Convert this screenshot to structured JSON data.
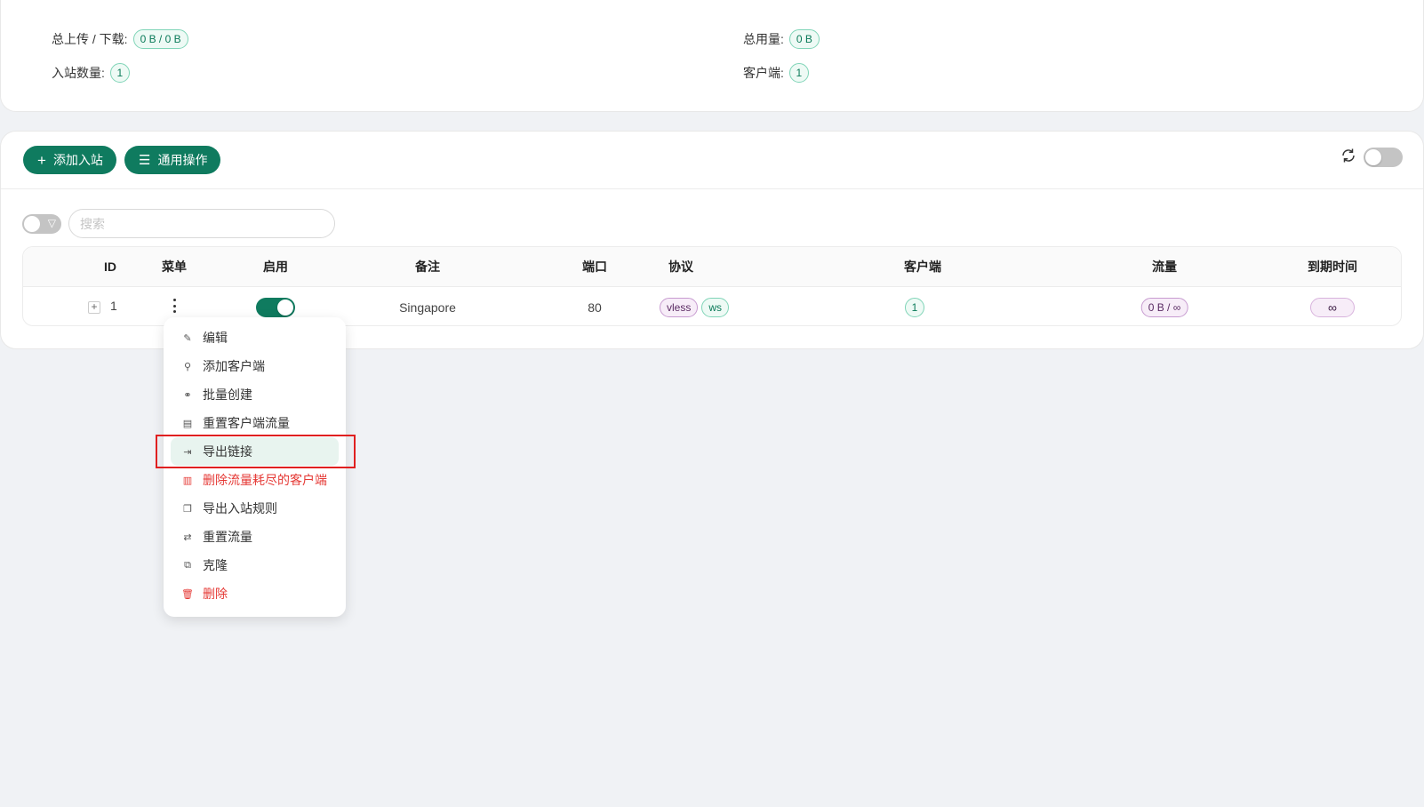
{
  "stats": {
    "total_updown_label": "总上传 / 下载:",
    "total_updown_value": "0 B / 0 B",
    "total_usage_label": "总用量:",
    "total_usage_value": "0 B",
    "inbound_count_label": "入站数量:",
    "inbound_count_value": "1",
    "clients_label": "客户端:",
    "clients_value": "1"
  },
  "toolbar": {
    "add_inbound_label": "添加入站",
    "general_actions_label": "通用操作"
  },
  "search": {
    "placeholder": "搜索"
  },
  "table": {
    "headers": {
      "id": "ID",
      "menu": "菜单",
      "enable": "启用",
      "remark": "备注",
      "port": "端口",
      "protocol": "协议",
      "clients": "客户端",
      "traffic": "流量",
      "expiry": "到期时间"
    },
    "rows": [
      {
        "id": "1",
        "remark": "Singapore",
        "port": "80",
        "protocol": "vless",
        "transport": "ws",
        "clients": "1",
        "traffic": "0 B / ∞",
        "expiry": "∞",
        "enabled": true
      }
    ]
  },
  "menu": {
    "items": [
      {
        "label": "编辑",
        "icon": "edit-icon"
      },
      {
        "label": "添加客户端",
        "icon": "user-add-icon"
      },
      {
        "label": "批量创建",
        "icon": "users-icon"
      },
      {
        "label": "重置客户端流量",
        "icon": "file-reset-icon"
      },
      {
        "label": "导出链接",
        "icon": "export-icon"
      },
      {
        "label": "删除流量耗尽的客户端",
        "icon": "delete-depleted-icon"
      },
      {
        "label": "导出入站规则",
        "icon": "copy-icon"
      },
      {
        "label": "重置流量",
        "icon": "retweet-icon"
      },
      {
        "label": "克隆",
        "icon": "clone-icon"
      },
      {
        "label": "删除",
        "icon": "trash-icon"
      }
    ]
  },
  "colors": {
    "primary": "#0f7b5f",
    "danger": "#e53935",
    "highlight": "#e02020"
  }
}
